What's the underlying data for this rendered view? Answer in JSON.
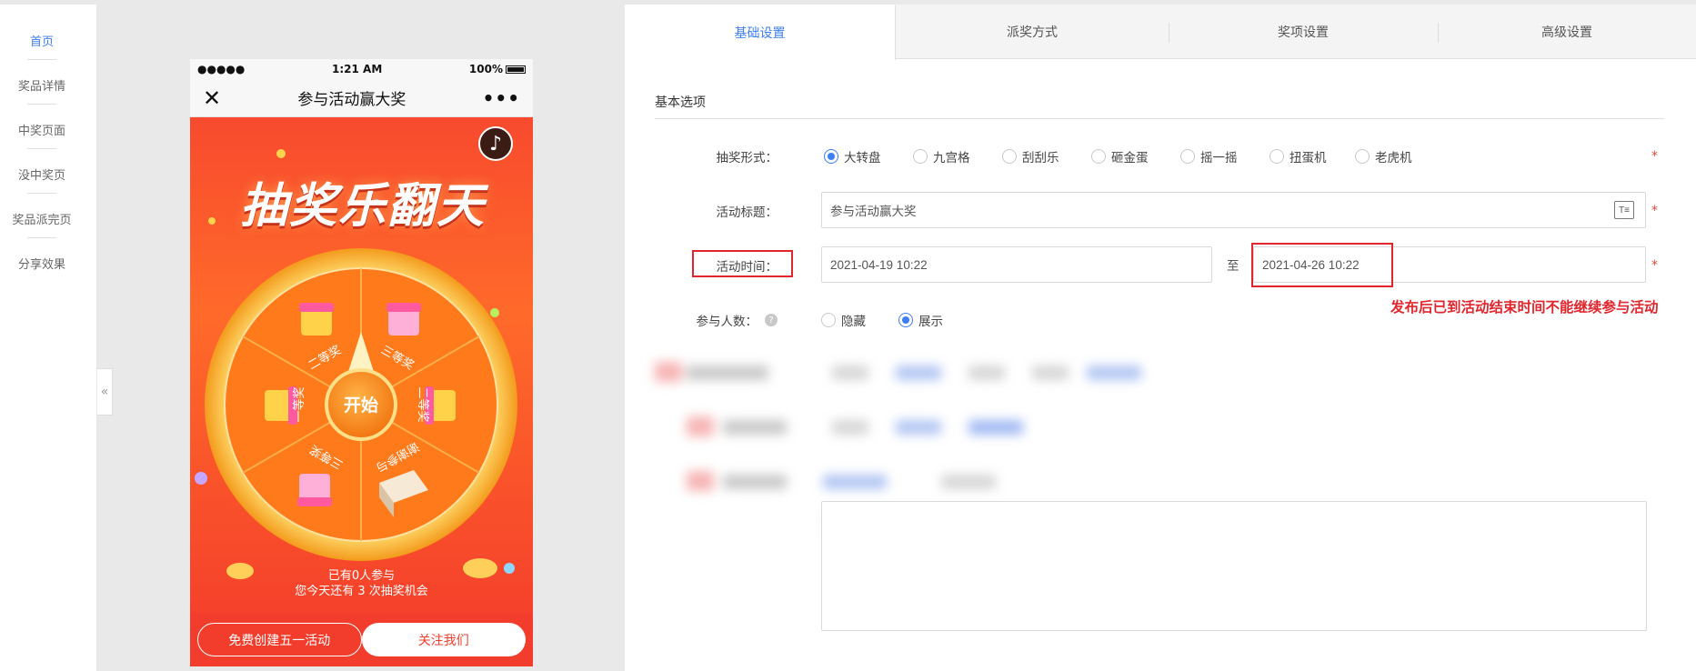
{
  "left_nav": {
    "items": [
      {
        "label": "首页",
        "active": true
      },
      {
        "label": "奖品详情",
        "active": false
      },
      {
        "label": "中奖页面",
        "active": false
      },
      {
        "label": "没中奖页",
        "active": false
      },
      {
        "label": "奖品派完页",
        "active": false
      },
      {
        "label": "分享效果",
        "active": false
      }
    ],
    "collapse_glyph": "«"
  },
  "phone": {
    "status": {
      "signal": "●●●●●",
      "time": "1:21 AM",
      "battery": "100%"
    },
    "navbar": {
      "close_glyph": "✕",
      "title": "参与活动赢大奖",
      "more_glyph": "•••"
    },
    "banner_title": "抽奖乐翻天",
    "music_glyph": "♪",
    "wheel": {
      "center_label": "开始",
      "prizes": [
        "一等奖",
        "二等奖",
        "三等奖",
        "二等奖",
        "谢谢参与",
        "三等奖"
      ]
    },
    "info_line1": "已有0人参与",
    "info_line2": "您今天还有 3 次抽奖机会",
    "btn_create": "免费创建五一活动",
    "btn_follow": "关注我们"
  },
  "tabs": [
    {
      "label": "基础设置",
      "active": true
    },
    {
      "label": "派奖方式",
      "active": false
    },
    {
      "label": "奖项设置",
      "active": false
    },
    {
      "label": "高级设置",
      "active": false
    }
  ],
  "form": {
    "section_title": "基本选项",
    "lottery_type": {
      "label": "抽奖形式：",
      "options": [
        "大转盘",
        "九宫格",
        "刮刮乐",
        "砸金蛋",
        "摇一摇",
        "扭蛋机",
        "老虎机"
      ],
      "selected": "大转盘"
    },
    "activity_title": {
      "label": "活动标题：",
      "value": "参与活动赢大奖",
      "icon": "title-format-icon"
    },
    "activity_time": {
      "label": "活动时间：",
      "start": "2021-04-19 10:22",
      "to": "至",
      "end": "2021-04-26 10:22"
    },
    "participants": {
      "label": "参与人数：",
      "help": "?",
      "options": [
        "隐藏",
        "展示"
      ],
      "selected": "展示"
    },
    "required_mark": "*",
    "annotation": "发布后已到活动结束时间不能继续参与活动"
  },
  "colors": {
    "accent": "#3d7ef0",
    "annotation_red": "#e1262d",
    "banner_red": "#f84a2e"
  }
}
